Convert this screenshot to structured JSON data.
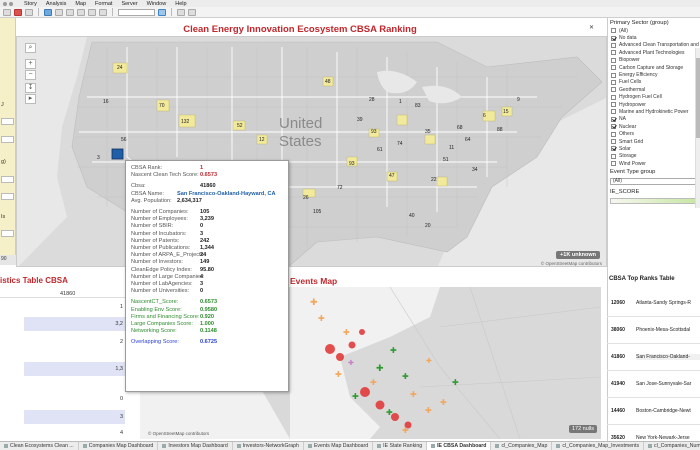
{
  "menu": [
    "Story",
    "Analysis",
    "Map",
    "Format",
    "Server",
    "Window",
    "Help"
  ],
  "left_sidebar": {
    "labels": [
      "J",
      "g)",
      "Is",
      "90"
    ]
  },
  "main_map": {
    "title": "Clean Energy Innovation Ecosystem CBSA Ranking",
    "country_label_line1": "United",
    "country_label_line2": "States",
    "unknown_badge": "+1K unknown",
    "attribution": "© OpenStreetMap contributors",
    "rank_labels": [
      {
        "t": "24"
      },
      {
        "t": "16"
      },
      {
        "t": "70"
      },
      {
        "t": "132"
      },
      {
        "t": "52"
      },
      {
        "t": "12"
      },
      {
        "t": "56"
      },
      {
        "t": "48"
      },
      {
        "t": "3"
      },
      {
        "t": "28"
      },
      {
        "t": "1"
      },
      {
        "t": "83"
      },
      {
        "t": "93"
      },
      {
        "t": "74"
      },
      {
        "t": "35"
      },
      {
        "t": "11"
      },
      {
        "t": "6"
      },
      {
        "t": "15"
      },
      {
        "t": "68"
      },
      {
        "t": "64"
      },
      {
        "t": "22"
      },
      {
        "t": "47"
      },
      {
        "t": "93"
      },
      {
        "t": "72"
      },
      {
        "t": "26"
      },
      {
        "t": "105"
      },
      {
        "t": "40"
      },
      {
        "t": "20"
      },
      {
        "t": "34"
      },
      {
        "t": "9"
      },
      {
        "t": "88"
      },
      {
        "t": "61"
      },
      {
        "t": "39"
      },
      {
        "t": "51"
      }
    ]
  },
  "tooltip": {
    "rank_label": "CBSA Rank:",
    "rank_value": "1",
    "nascent_label": "Nascent Clean Tech Score:",
    "nascent_value": "0.6573",
    "cbsa_label": "Cbsa:",
    "cbsa_value": "41860",
    "name_label": "CBSA Name:",
    "name_value": "San Francisco-Oakland-Hayward, CA",
    "pop_label": "Avg. Population:",
    "pop_value": "2,634,317",
    "metrics": [
      {
        "k": "Number of Companies:",
        "v": "105"
      },
      {
        "k": "Number of Employees:",
        "v": "3,239"
      },
      {
        "k": "Number of SBIR:",
        "v": "0"
      },
      {
        "k": "Number of Incubators:",
        "v": "3"
      },
      {
        "k": "Number of Patents:",
        "v": "242"
      },
      {
        "k": "Number of Publications:",
        "v": "1,344"
      },
      {
        "k": "Number of ARPA_E_Projects:",
        "v": "24"
      },
      {
        "k": "Number of Investors:",
        "v": "149"
      },
      {
        "k": "CleanEdge Policy Index:",
        "v": "95.80"
      },
      {
        "k": "Number of Large Companies:",
        "v": "4"
      },
      {
        "k": "Number of LabAgencies:",
        "v": "3"
      },
      {
        "k": "Number of Universities:",
        "v": "0"
      }
    ],
    "scores": [
      {
        "k": "NascentCT_Score:",
        "v": "0.6573"
      },
      {
        "k": "Enabling Env Score:",
        "v": "0.9580"
      },
      {
        "k": "Firms and Financing Score:",
        "v": "0.920"
      },
      {
        "k": "Large Companies Score:",
        "v": "1.000"
      },
      {
        "k": "Networking Score:",
        "v": "0.1148"
      }
    ],
    "overlap_label": "Overlapping Score:",
    "overlap_value": "0.6725"
  },
  "right_panel": {
    "sector_title": "Primary Sector (group)",
    "sectors": [
      {
        "label": "(All)",
        "checked": false
      },
      {
        "label": "No data",
        "checked": true
      },
      {
        "label": "Advanced Clean Transportation and",
        "checked": false
      },
      {
        "label": "Advanced Plant Technologies",
        "checked": false
      },
      {
        "label": "Biopower",
        "checked": false
      },
      {
        "label": "Carbon Capture and Storage",
        "checked": false
      },
      {
        "label": "Energy Efficiency",
        "checked": false
      },
      {
        "label": "Fuel Cells",
        "checked": false
      },
      {
        "label": "Geothermal",
        "checked": false
      },
      {
        "label": "Hydrogen Fuel Cell",
        "checked": false
      },
      {
        "label": "Hydropower",
        "checked": false
      },
      {
        "label": "Marine and Hydrokinetic Power",
        "checked": false
      },
      {
        "label": "NA",
        "checked": true
      },
      {
        "label": "Nuclear",
        "checked": true
      },
      {
        "label": "Others",
        "checked": false
      },
      {
        "label": "Smart Grid",
        "checked": false
      },
      {
        "label": "Solar",
        "checked": true
      },
      {
        "label": "Storage",
        "checked": false
      },
      {
        "label": "Wind Power",
        "checked": false
      }
    ],
    "event_title": "Event Type group",
    "event_value": "(All)",
    "ie_title": "IE_SCORE"
  },
  "ranks_table": {
    "title": "CBSA Top Ranks Table",
    "rows": [
      {
        "id": "12060",
        "name": "Atlanta-Sandy Springs-R"
      },
      {
        "id": "38060",
        "name": "Phoenix-Mesa-Scottsdal"
      },
      {
        "id": "41860",
        "name": "San Francisco-Oakland-"
      },
      {
        "id": "41940",
        "name": "San Jose-Sunnyvale-Sar"
      },
      {
        "id": "14460",
        "name": "Boston-Cambridge-Newt"
      },
      {
        "id": "35620",
        "name": "New York-Newark-Jerse"
      }
    ]
  },
  "stats": {
    "title": "istics Table CBSA",
    "header": "41860",
    "values": [
      "1",
      "3,2",
      "2",
      "1,3",
      "0",
      "3",
      "4"
    ]
  },
  "events_map": {
    "title": "Events Map",
    "nulls_badge": "172 nulls",
    "attribution": "© OpenStreetMap contributors"
  },
  "tabs": [
    {
      "label": "Clean Ecosystems Clean ..."
    },
    {
      "label": "Companies Map Dashboard"
    },
    {
      "label": "Investors Map Dashboard"
    },
    {
      "label": "Investors-NetworkGraph"
    },
    {
      "label": "Events Map Dashboard"
    },
    {
      "label": "IE State Ranking"
    },
    {
      "label": "IE CBSA Dashboard"
    },
    {
      "label": "cl_Companies_Map"
    },
    {
      "label": "cl_Companies_Map_Investments"
    },
    {
      "label": "cl_Companies_Number"
    }
  ],
  "colors": {
    "title_red": "#c0272d",
    "map_bg": "#dbdbdb",
    "selected_blue": "#1f5fa8",
    "score_green": "#2e8b2e",
    "overlap_blue": "#2a3fd0"
  }
}
